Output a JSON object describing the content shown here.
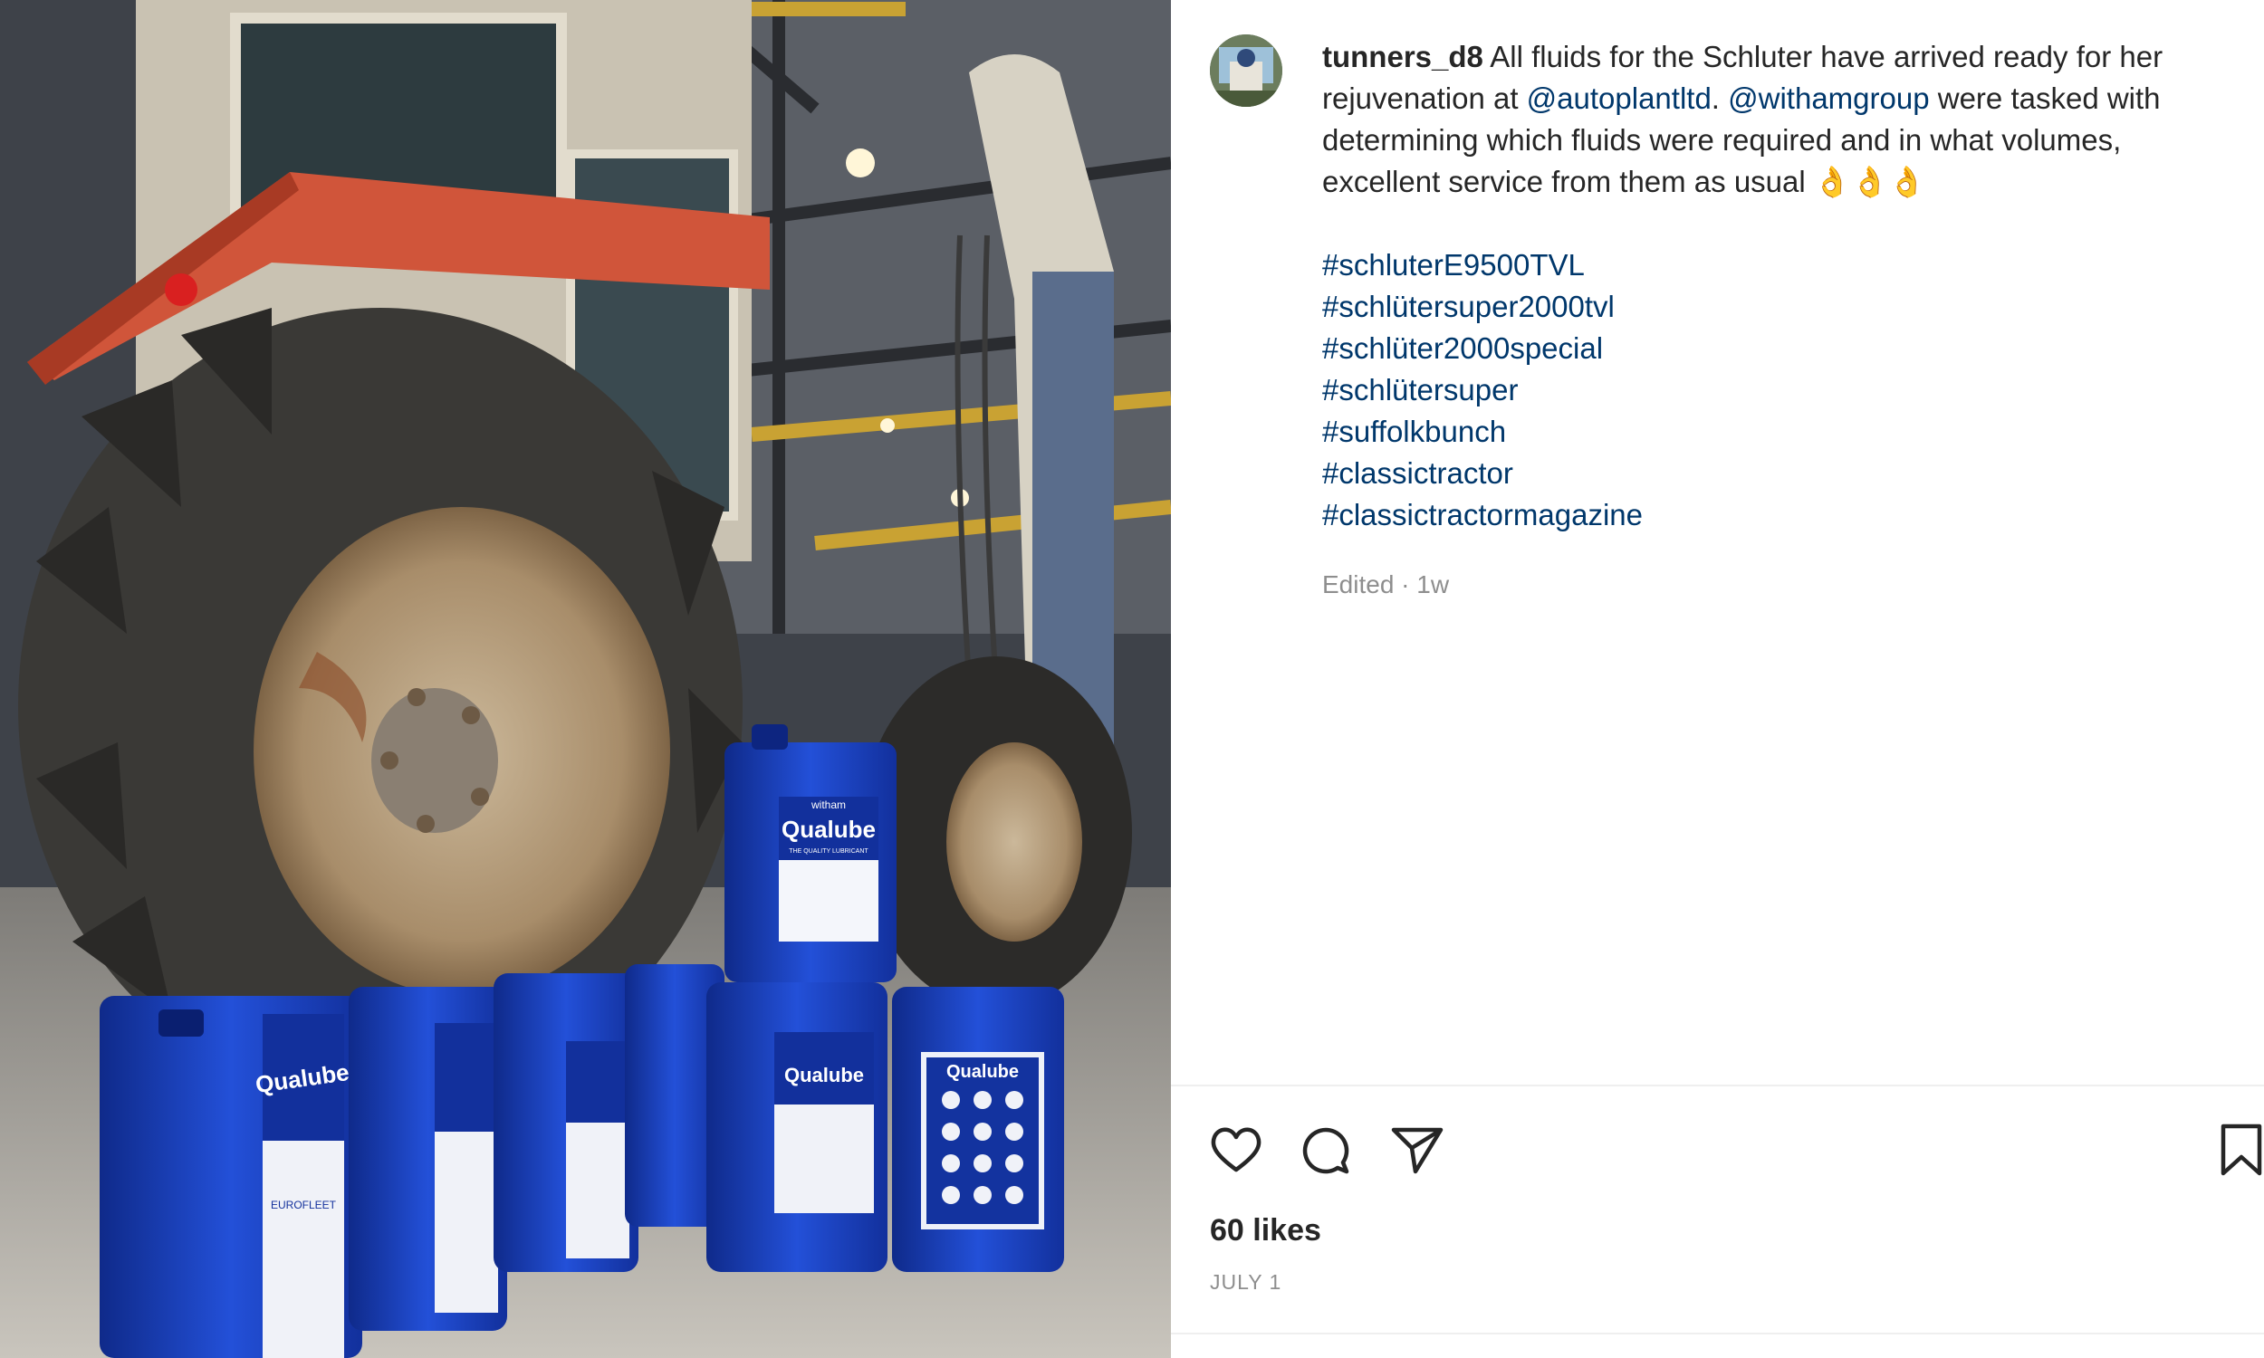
{
  "post": {
    "username": "tunners_d8",
    "caption_parts": {
      "intro": " All fluids for the Schluter have arrived ready for her rejuvenation at ",
      "mention1": "@autoplantltd",
      "between": ". ",
      "mention2": "@withamgroup",
      "outro": " were tasked with determining which fluids were required and in what volumes, excellent service from them as usual 👌👌👌"
    },
    "hashtags": [
      "#schluterE9500TVL",
      "#schlütersuper2000tvl",
      "#schlüter2000special",
      "#schlütersuper",
      "#suffolkbunch",
      "#classictractor",
      "#classictractormagazine"
    ],
    "edited_label": "Edited · 1w",
    "likes": "60 likes",
    "date": "JULY 1"
  },
  "photo": {
    "can_brand_top": "witham",
    "can_brand": "Qualube",
    "can_tagline": "THE QUALITY LUBRICANT",
    "can_label_eurofleet": "EUROFLEET"
  },
  "icons": {
    "like": "heart-icon",
    "comment": "comment-icon",
    "share": "paper-plane-icon",
    "save": "bookmark-icon"
  },
  "colors": {
    "link": "#00376b",
    "text": "#262626",
    "secondary": "#8e8e8e",
    "can_blue": "#1a3fb8"
  }
}
